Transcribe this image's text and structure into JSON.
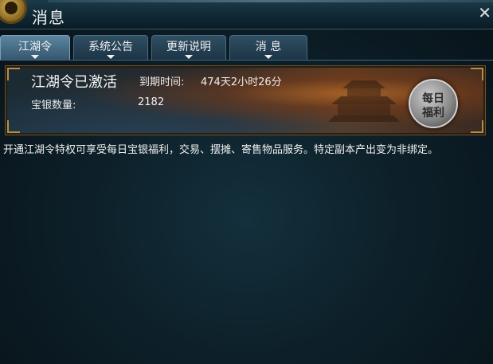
{
  "window": {
    "title": "消息",
    "close_glyph": "✕"
  },
  "tabs": [
    {
      "label": "江湖令",
      "active": true
    },
    {
      "label": "系统公告",
      "active": false
    },
    {
      "label": "更新说明",
      "active": false
    },
    {
      "label": "消 息",
      "active": false
    }
  ],
  "banner": {
    "status": "江湖令已激活",
    "expiry_label": "到期时间:",
    "expiry_value": "474天2小时26分",
    "silver_label": "宝银数量:",
    "silver_value": "2182",
    "welfare_button": {
      "line1": "每日",
      "line2": "福利"
    }
  },
  "description": "开通江湖令特权可享受每日宝银福利，交易、摆摊、寄售物品服务。特定副本产出变为非绑定。",
  "icons": [
    "gear-icon",
    "close-icon",
    "chevron-down-icon",
    "pagoda-icon"
  ],
  "colors": {
    "background": "#0b1820",
    "tab_active": "#5b85a0",
    "tab_inactive": "#2f4f63",
    "banner_border": "#b4904a"
  }
}
